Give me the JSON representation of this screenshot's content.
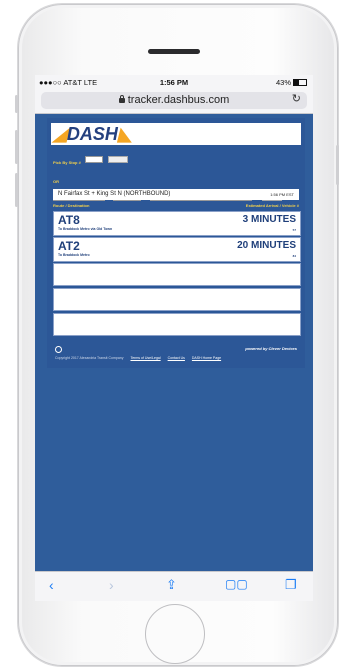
{
  "status": {
    "carrier": "●●●○○ AT&T  LTE",
    "time": "1:56 PM",
    "battery": "43%"
  },
  "browser": {
    "url": "tracker.dashbus.com"
  },
  "site": {
    "logo": "DASH",
    "form": {
      "stop_label": "Pick By Stop #",
      "or_label": "OR",
      "go_button": "Map"
    },
    "selected_stop": "N Fairfax St + King St N (NORTHBOUND)",
    "time": "1:56 PM EST",
    "headers": {
      "route": "Route / Destination",
      "estimate": "Estimated Arrival / Vehicle #"
    },
    "arrivals": [
      {
        "route": "AT8",
        "destination": "To Braddock Metro via Old Town",
        "eta": "3 MINUTES",
        "vehicle": "57"
      },
      {
        "route": "AT2",
        "destination": "To Braddock Metro",
        "eta": "20 MINUTES",
        "vehicle": "84"
      }
    ],
    "powered_by": "powered by Clever Devices",
    "copyright": "Copyright 2017 Alexandria Transit Company",
    "links": [
      "Terms of Use/Legal",
      "Contact Us",
      "DASH Home Page"
    ]
  }
}
